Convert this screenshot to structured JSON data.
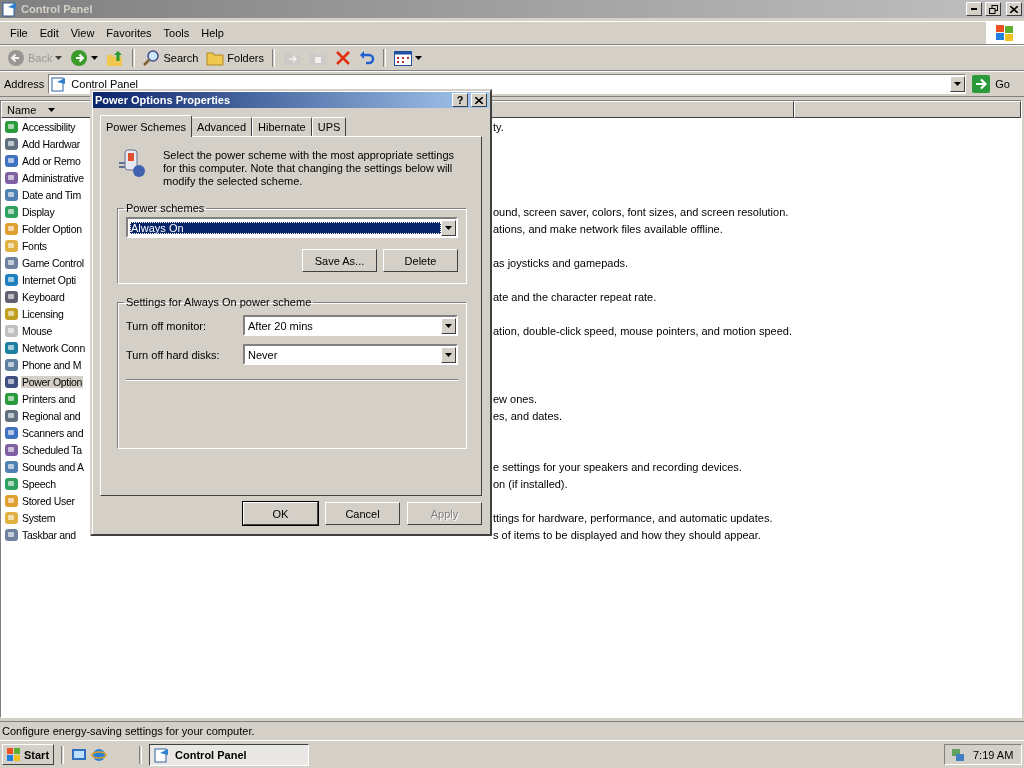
{
  "window": {
    "title": "Control Panel"
  },
  "menu": [
    {
      "label": "File"
    },
    {
      "label": "Edit"
    },
    {
      "label": "View"
    },
    {
      "label": "Favorites"
    },
    {
      "label": "Tools"
    },
    {
      "label": "Help"
    }
  ],
  "toolbar": [
    {
      "kind": "back",
      "label": "Back",
      "disabled": true
    },
    {
      "kind": "forward"
    },
    {
      "kind": "up"
    },
    {
      "kind": "search",
      "label": "Search"
    },
    {
      "kind": "folders",
      "label": "Folders"
    },
    {
      "kind": "move",
      "disabled": true
    },
    {
      "kind": "copy",
      "disabled": true
    },
    {
      "kind": "delete"
    },
    {
      "kind": "undo"
    },
    {
      "kind": "views"
    }
  ],
  "address": {
    "label": "Address",
    "value": "Control Panel",
    "go": "Go"
  },
  "list": {
    "columns": [
      {
        "label": "Name"
      }
    ],
    "rows": [
      {
        "name": "Accessibility",
        "comment": "ty.",
        "selected": false
      },
      {
        "name": "Add Hardwar",
        "selected": false
      },
      {
        "name": "Add or Remo",
        "selected": false
      },
      {
        "name": "Administrative",
        "selected": false
      },
      {
        "name": "Date and Tim",
        "selected": false
      },
      {
        "name": "Display",
        "comment": "ound, screen saver, colors, font sizes, and screen resolution.",
        "selected": false
      },
      {
        "name": "Folder Option",
        "comment": "ations, and make network files available offline.",
        "selected": false
      },
      {
        "name": "Fonts",
        "selected": false
      },
      {
        "name": "Game Control",
        "comment": "as joysticks and gamepads.",
        "selected": false
      },
      {
        "name": "Internet Opti",
        "selected": false
      },
      {
        "name": "Keyboard",
        "comment": "ate and the character repeat rate.",
        "selected": false
      },
      {
        "name": "Licensing",
        "selected": false
      },
      {
        "name": "Mouse",
        "comment": "ation, double-click speed, mouse pointers, and motion speed.",
        "selected": false
      },
      {
        "name": "Network Conn",
        "selected": false
      },
      {
        "name": "Phone and M",
        "selected": false
      },
      {
        "name": "Power Option",
        "selected": true
      },
      {
        "name": "Printers and",
        "comment": "ew ones.",
        "selected": false
      },
      {
        "name": "Regional and",
        "comment": "es, and dates.",
        "selected": false
      },
      {
        "name": "Scanners and",
        "selected": false
      },
      {
        "name": "Scheduled Ta",
        "selected": false
      },
      {
        "name": "Sounds and A",
        "comment": "e settings for your speakers and recording devices.",
        "selected": false
      },
      {
        "name": "Speech",
        "comment": "on (if installed).",
        "selected": false
      },
      {
        "name": "Stored User",
        "selected": false
      },
      {
        "name": "System",
        "comment": "ttings for hardware, performance, and automatic updates.",
        "selected": false
      },
      {
        "name": "Taskbar and",
        "comment": "s of items to be displayed and how they should appear.",
        "selected": false
      }
    ]
  },
  "dialog": {
    "title": "Power Options Properties",
    "help": "?",
    "tabs": [
      {
        "label": "Power Schemes",
        "selected": true
      },
      {
        "label": "Advanced",
        "selected": false
      },
      {
        "label": "Hibernate",
        "selected": false
      },
      {
        "label": "UPS",
        "selected": false
      }
    ],
    "description": "Select the power scheme with the most appropriate settings for this computer. Note that changing the settings below will modify the selected scheme.",
    "schemes_group": {
      "label": "Power schemes",
      "value": "Always On",
      "buttons": [
        {
          "label": "Save As..."
        },
        {
          "label": "Delete"
        }
      ]
    },
    "settings_group": {
      "label": "Settings for Always On power scheme",
      "fields": [
        {
          "label": "Turn off monitor:",
          "value": "After 20 mins"
        },
        {
          "label": "Turn off hard disks:",
          "value": "Never"
        }
      ]
    },
    "buttons": [
      {
        "label": "OK",
        "disabled": false,
        "default": true
      },
      {
        "label": "Cancel",
        "disabled": false,
        "default": false
      },
      {
        "label": "Apply",
        "disabled": true,
        "default": false
      }
    ]
  },
  "status_bar": "Configure energy-saving settings for your computer.",
  "taskbar": {
    "start": "Start",
    "tasks": [
      {
        "label": "Control Panel",
        "selected": true
      }
    ],
    "clock": "7:19 AM"
  }
}
